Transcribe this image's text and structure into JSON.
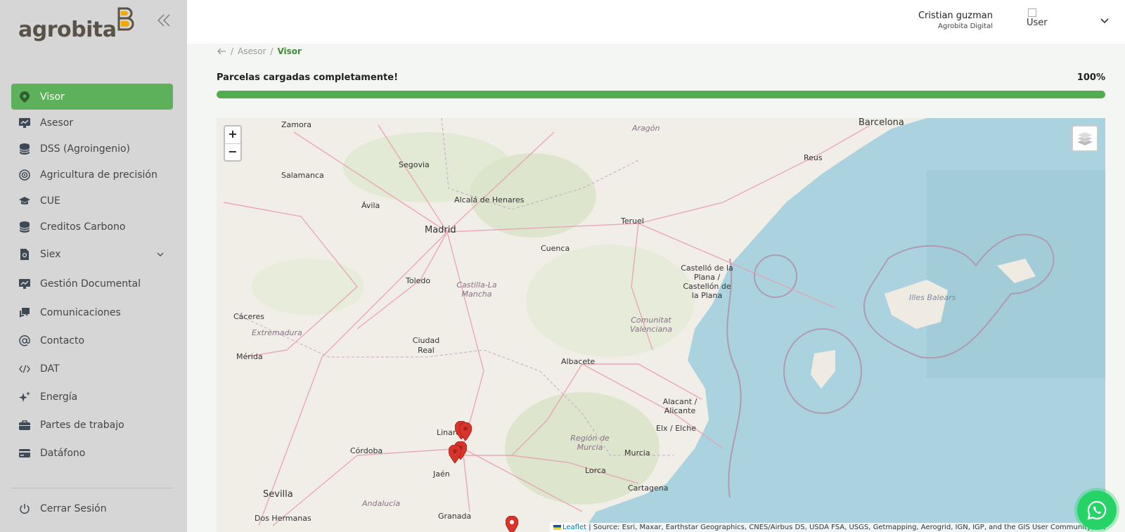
{
  "brand": {
    "name": "agrobita"
  },
  "sidebar": {
    "items": [
      {
        "label": "Visor",
        "icon": "map-pin-icon"
      },
      {
        "label": "Asesor",
        "icon": "chart-board-icon"
      },
      {
        "label": "DSS (Agroingenio)",
        "icon": "database-icon"
      },
      {
        "label": "Agricultura de precisión",
        "icon": "target-icon"
      },
      {
        "label": "CUE",
        "icon": "graduation-cap-icon"
      },
      {
        "label": "Creditos Carbono",
        "icon": "database-icon"
      },
      {
        "label": "Siex",
        "icon": "document-icon"
      },
      {
        "label": "Gestión Documental",
        "icon": "chart-board-icon"
      },
      {
        "label": "Comunicaciones",
        "icon": "chat-icon"
      },
      {
        "label": "Contacto",
        "icon": "at-icon"
      },
      {
        "label": "DAT",
        "icon": "code-icon"
      },
      {
        "label": "Energía",
        "icon": "sparkle-icon"
      },
      {
        "label": "Partes de trabajo",
        "icon": "briefcase-icon"
      },
      {
        "label": "Datáfono",
        "icon": "card-icon"
      }
    ],
    "logout_label": "Cerrar Sesión"
  },
  "header": {
    "user_name": "Cristian guzman",
    "user_org": "Agrobita Digital",
    "avatar_alt": "User"
  },
  "breadcrumb": {
    "parent": "Asesor",
    "current": "Visor"
  },
  "progress": {
    "label": "Parcelas cargadas completamente!",
    "percent_text": "100%",
    "value": 100
  },
  "map": {
    "zoom_in": "+",
    "zoom_out": "−",
    "cities": [
      "Zamora",
      "Barcelona",
      "Salamanca",
      "Segovia",
      "Reus",
      "Alcalá de Henares",
      "Ávila",
      "Madrid",
      "Teruel",
      "Cuenca",
      "Toledo",
      "Castelló de la Plana / Castellón de la Plana",
      "Cáceres",
      "Ciudad Real",
      "Mérida",
      "Albacete",
      "Alacant / Alicante",
      "Elx / Elche",
      "Linares",
      "Córdoba",
      "Murcia",
      "Lorca",
      "Jaén",
      "Cartagena",
      "Sevilla",
      "Granada",
      "Dos Hermanas"
    ],
    "regions": [
      "Aragón",
      "Castilla-La Mancha",
      "Comunitat Valenciana",
      "Illes Balears",
      "Extremadura",
      "Región de Murcia",
      "Andalucía"
    ],
    "attribution_link": "Leaflet",
    "attribution_text": " | Source: Esri, Maxar, Earthstar Geographics, CNES/Airbus DS, USDA FSA, USGS, Getmapping, Aerogrid, IGN, IGP, and the GIS User Community, SIGPAC"
  },
  "colors": {
    "accent": "#5cb15a",
    "sidebar": "#d6d6d6",
    "marker": "#d9342b",
    "sea": "#aad3df"
  }
}
